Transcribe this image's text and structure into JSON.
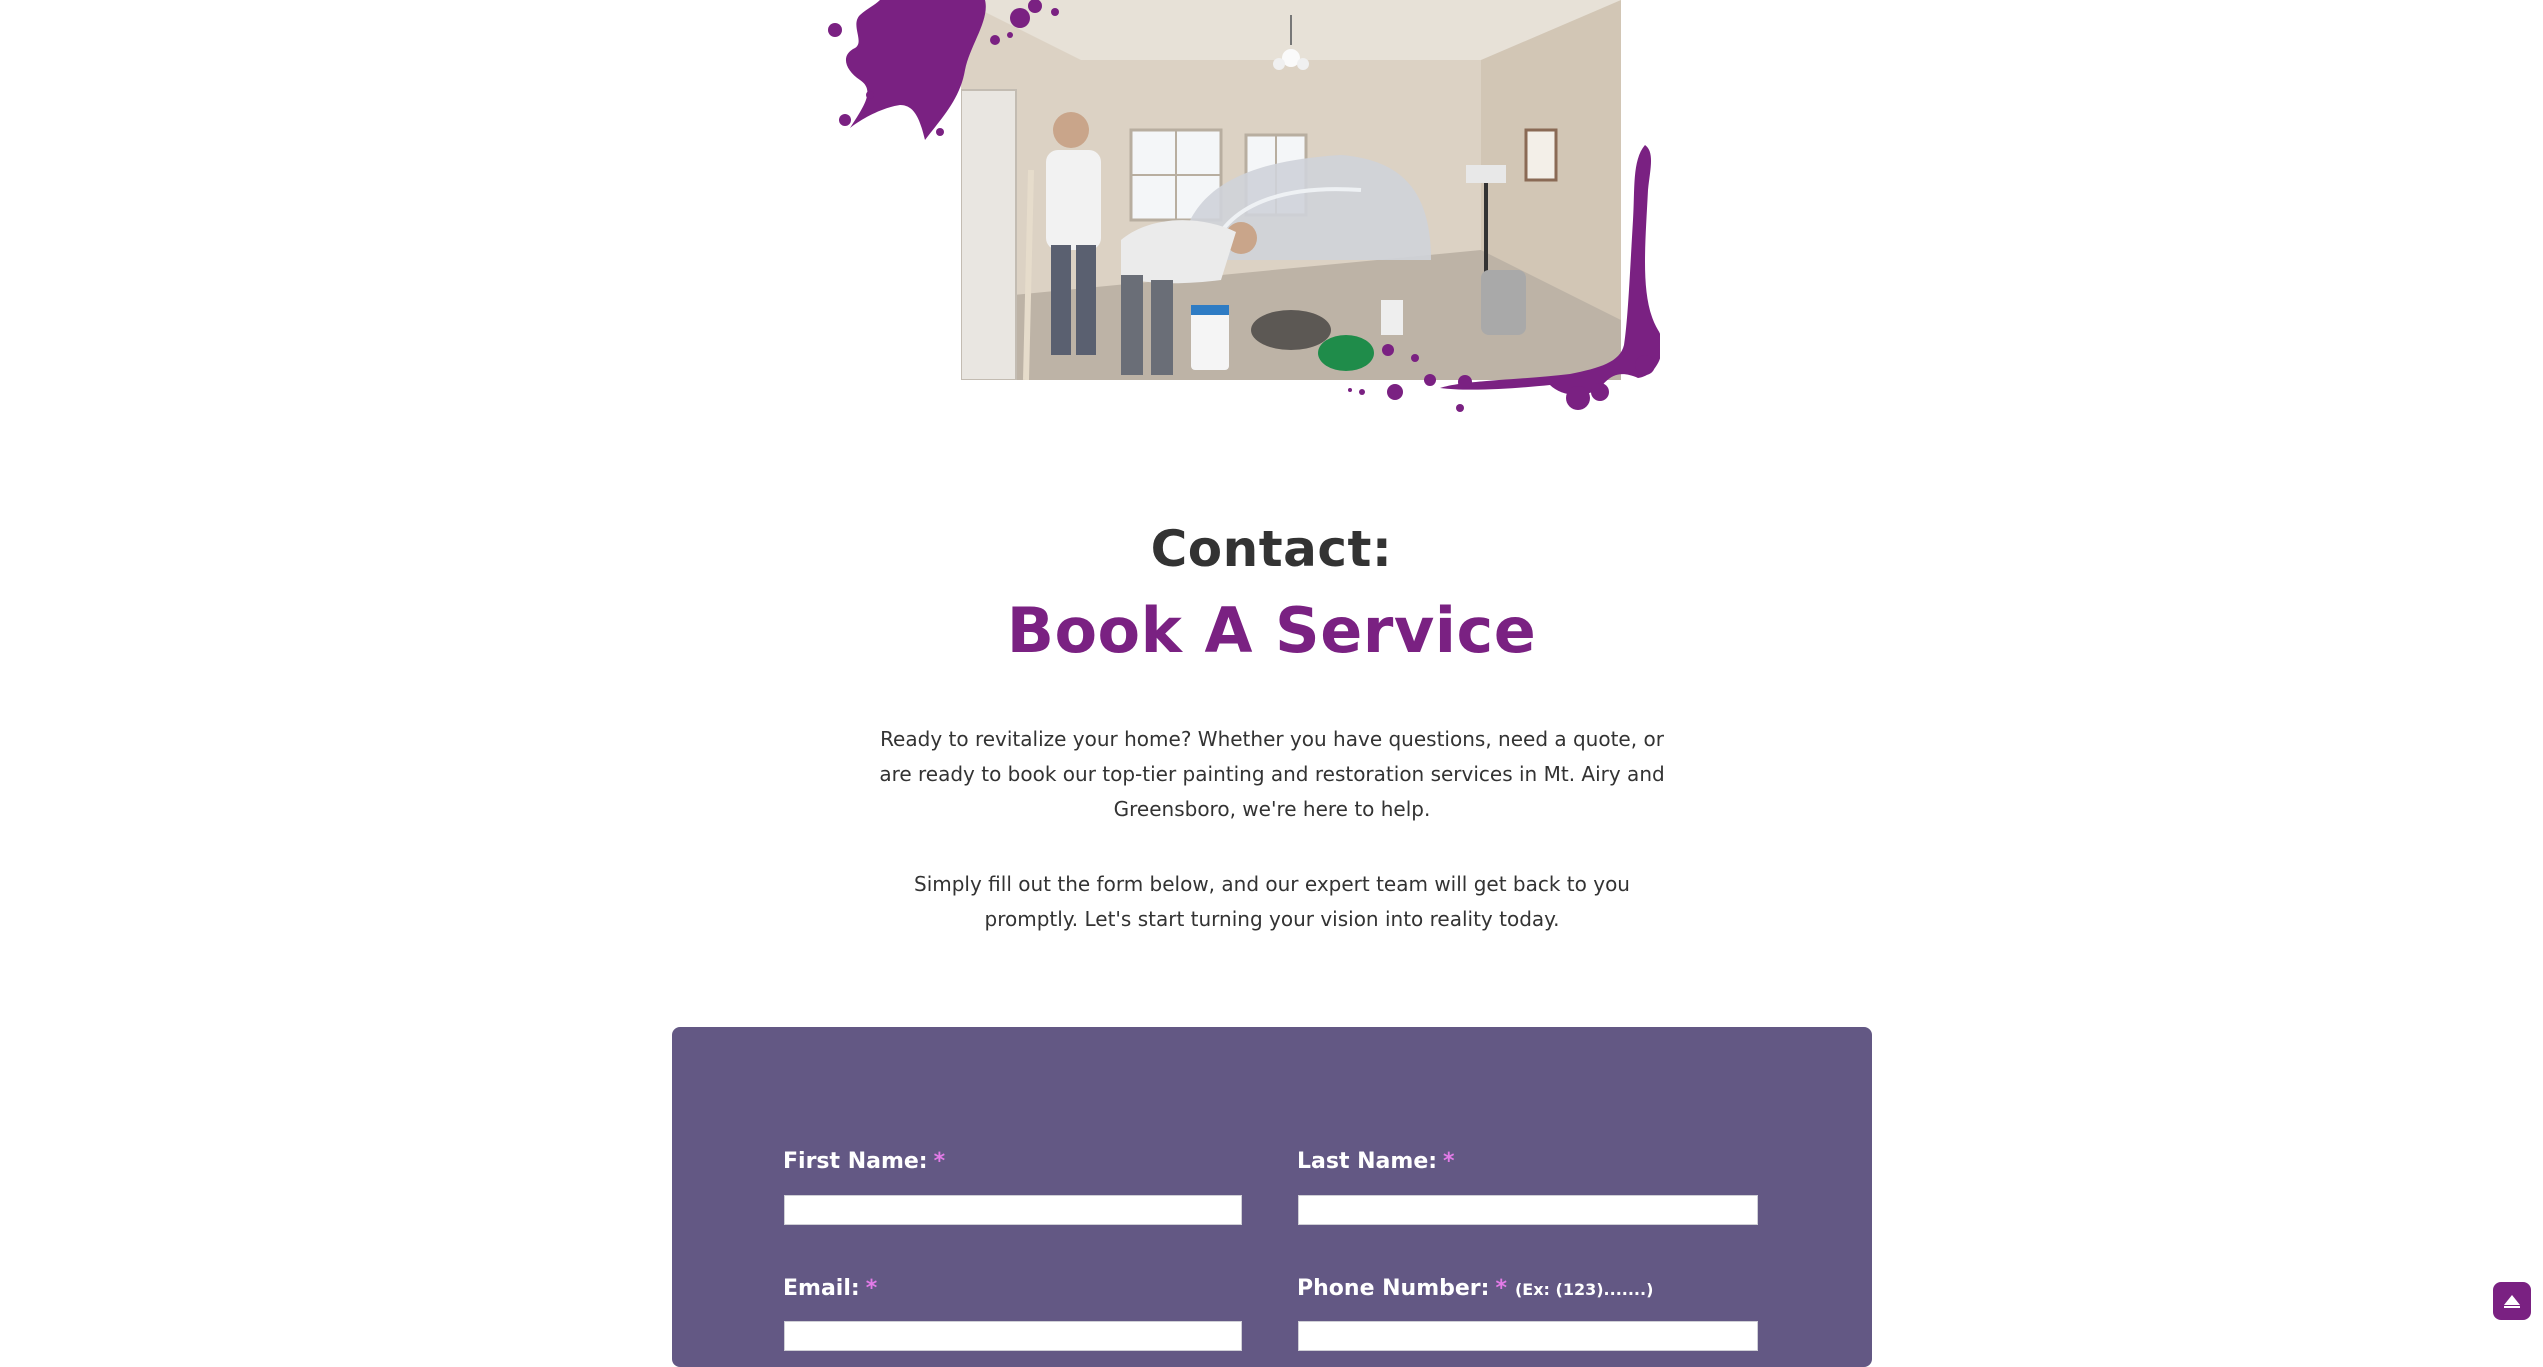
{
  "hero": {
    "photo_alt": "",
    "splatter_color": "#7a2182"
  },
  "contact": {
    "heading": "Contact:",
    "subheading": "Book A Service",
    "paragraph1": "Ready to revitalize your home? Whether you have questions, need a quote, or are ready to book our top-tier painting and restoration services in Mt. Airy and Greensboro, we're here to help.",
    "paragraph2": "Simply fill out the form below, and our expert team will get back to you promptly. Let's start turning your vision into reality today."
  },
  "form": {
    "first_name_label": "First Name:",
    "last_name_label": "Last Name:",
    "email_label": "Email:",
    "phone_label": "Phone Number:",
    "phone_hint": "(Ex: (123).......)",
    "required_mark": "*",
    "first_name_value": "",
    "last_name_value": "",
    "email_value": "",
    "phone_value": ""
  },
  "colors": {
    "accent": "#7a2182",
    "form_bg": "#635884",
    "required": "#e37be8"
  },
  "icons": {
    "scroll_top": "arrow-up-icon"
  }
}
